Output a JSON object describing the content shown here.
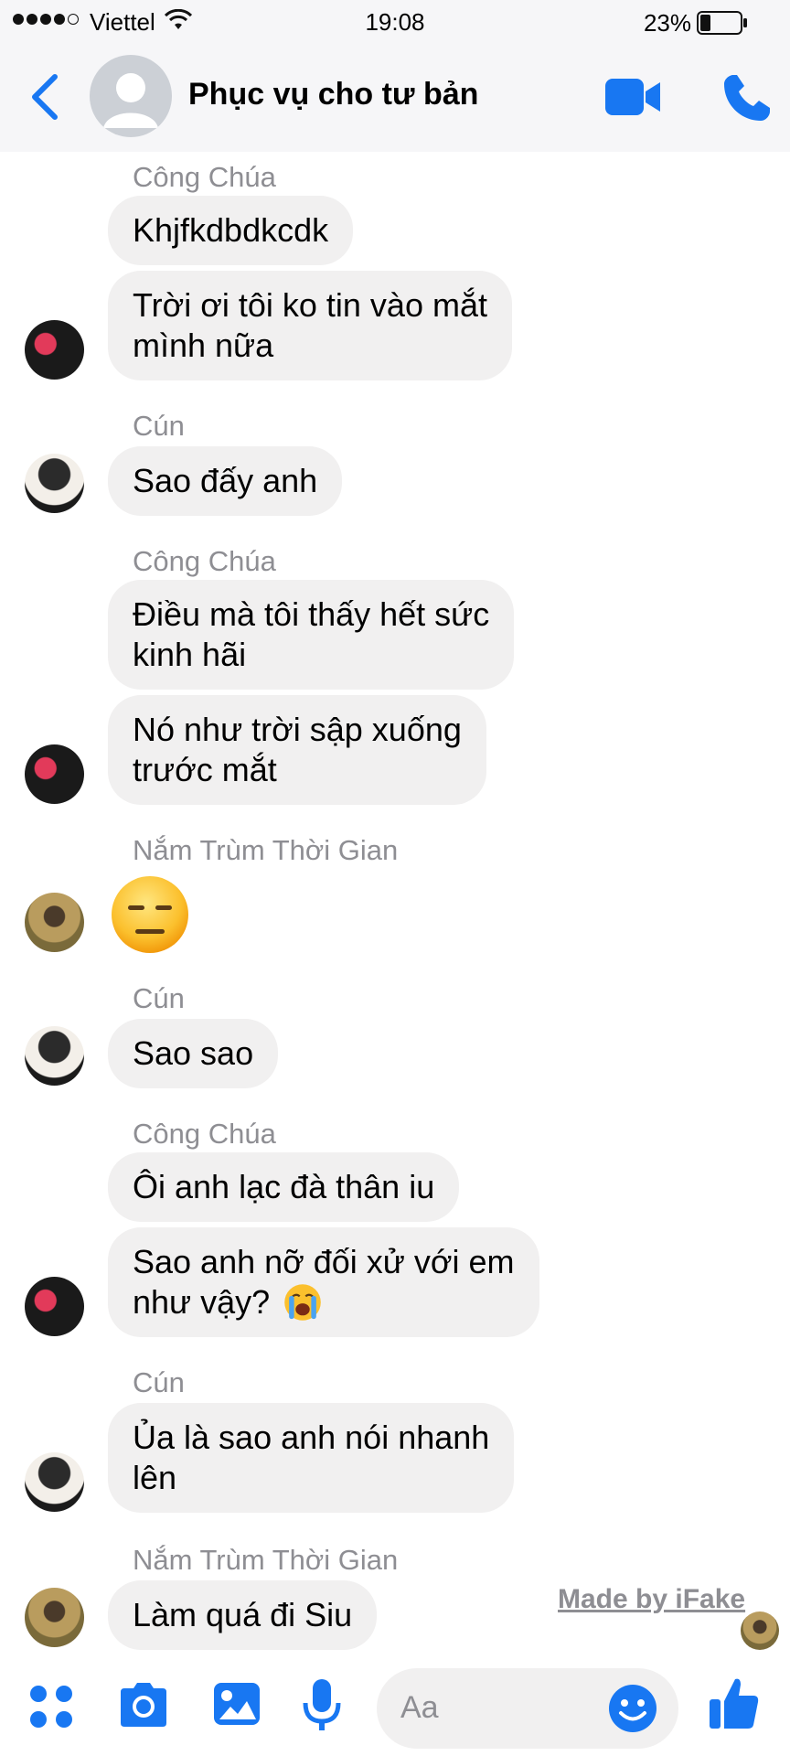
{
  "status_bar": {
    "carrier": "Viettel",
    "time": "19:08",
    "battery": "23%"
  },
  "header": {
    "title": "Phục vụ cho tư bản"
  },
  "messages": [
    {
      "sender": "Công Chúa",
      "bubbles": [
        "Khjfkdbdkcdk",
        "Trời ơi tôi ko tin vào mắt\nmình nữa"
      ]
    },
    {
      "sender": "Cún",
      "bubbles": [
        "Sao đấy anh"
      ]
    },
    {
      "sender": "Công Chúa",
      "bubbles": [
        "Điều mà tôi thấy hết sức\nkinh hãi",
        "Nó như trời sập xuống\ntrước mắt"
      ]
    },
    {
      "sender": "Nắm Trùm Thời Gian",
      "emoji": "expressionless-face"
    },
    {
      "sender": "Cún",
      "bubbles": [
        "Sao sao"
      ]
    },
    {
      "sender": "Công Chúa",
      "bubbles": [
        "Ôi anh lạc đà thân iu",
        "Sao anh nỡ đối xử với em\nnhư vậy?"
      ]
    },
    {
      "sender": "Cún",
      "bubbles": [
        "Ủa là sao anh nói nhanh\nlên"
      ]
    },
    {
      "sender": "Nắm Trùm Thời Gian",
      "bubbles": [
        "Làm quá đi Siu"
      ]
    }
  ],
  "watermark": "Made by iFake",
  "composer": {
    "placeholder": "Aa"
  },
  "colors": {
    "accent": "#1877f2",
    "bubble": "#f1f0f0",
    "sender": "#8e8e93"
  }
}
